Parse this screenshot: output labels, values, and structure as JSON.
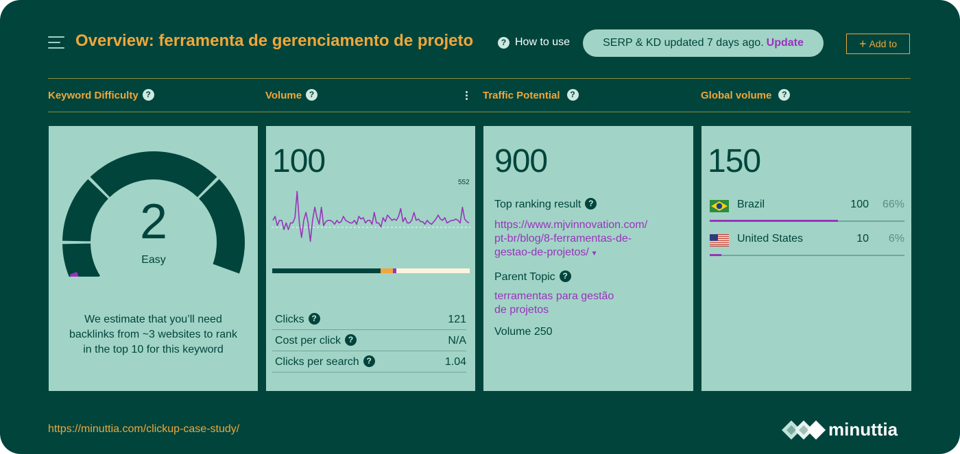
{
  "header": {
    "title": "Overview: ferramenta de gerenciamento de projeto",
    "how_to_use": "How to use",
    "serp_status": "SERP & KD updated 7 days ago.",
    "update_label": "Update",
    "add_to_label": "Add to"
  },
  "columns": {
    "kd": "Keyword Difficulty",
    "volume": "Volume",
    "traffic": "Traffic Potential",
    "global": "Global volume"
  },
  "keyword_difficulty": {
    "value": "2",
    "label": "Easy",
    "estimate_lines": [
      "We estimate that you’ll need",
      "backlinks from ~3 websites to rank",
      "in the top 10 for this keyword"
    ]
  },
  "volume": {
    "value": "100",
    "chart_max_label": "552",
    "trend": [
      44,
      50,
      36,
      44,
      44,
      30,
      40,
      30,
      40,
      40,
      48,
      88,
      40,
      18,
      44,
      56,
      40,
      12,
      44,
      64,
      48,
      38,
      64,
      36,
      42,
      44,
      44,
      42,
      38,
      44,
      40,
      42,
      50,
      44,
      42,
      40,
      40,
      44,
      38,
      50,
      46,
      48,
      40,
      44,
      44,
      38,
      56,
      40,
      40,
      34,
      48,
      42,
      52,
      48,
      44,
      46,
      44,
      50,
      62,
      42,
      48,
      40,
      40,
      44,
      56,
      44,
      46,
      42,
      42,
      38,
      44,
      40,
      38,
      42,
      46,
      52,
      46,
      44,
      48,
      40,
      42,
      44,
      44,
      46,
      44,
      40,
      64,
      46,
      42,
      40
    ],
    "distribution": [
      {
        "share": 0.55,
        "color": "#00443c"
      },
      {
        "share": 0.06,
        "color": "#f0a73a"
      },
      {
        "share": 0.02,
        "color": "#9933bb"
      },
      {
        "share": 0.37,
        "color": "#fdf3dc"
      }
    ],
    "metrics": [
      {
        "label": "Clicks",
        "value": "121"
      },
      {
        "label": "Cost per click",
        "value": "N/A"
      },
      {
        "label": "Clicks per search",
        "value": "1.04"
      }
    ]
  },
  "traffic_potential": {
    "value": "900",
    "top_ranking_label": "Top ranking result",
    "top_ranking_url_lines": [
      "https://www.mjvinnovation.com/",
      "pt-br/blog/8-ferramentas-de-",
      "gestao-de-projetos/"
    ],
    "parent_topic_label": "Parent Topic",
    "parent_topic_lines": [
      "terramentas para gestão",
      "de projetos"
    ],
    "parent_volume": "Volume 250"
  },
  "global_volume": {
    "value": "150",
    "countries": [
      {
        "name": "Brazil",
        "volume": "100",
        "percent": "66%",
        "share": 0.66,
        "flag": "brazil-flag"
      },
      {
        "name": "United States",
        "volume": "10",
        "percent": "6%",
        "share": 0.06,
        "flag": "us-flag"
      }
    ]
  },
  "footer": {
    "url": "https://minuttia.com/clickup-case-study/",
    "brand": "minuttia"
  },
  "colors": {
    "background": "#00443c",
    "card": "#a1d4c6",
    "accent": "#f0a73a",
    "link": "#9933bb"
  }
}
